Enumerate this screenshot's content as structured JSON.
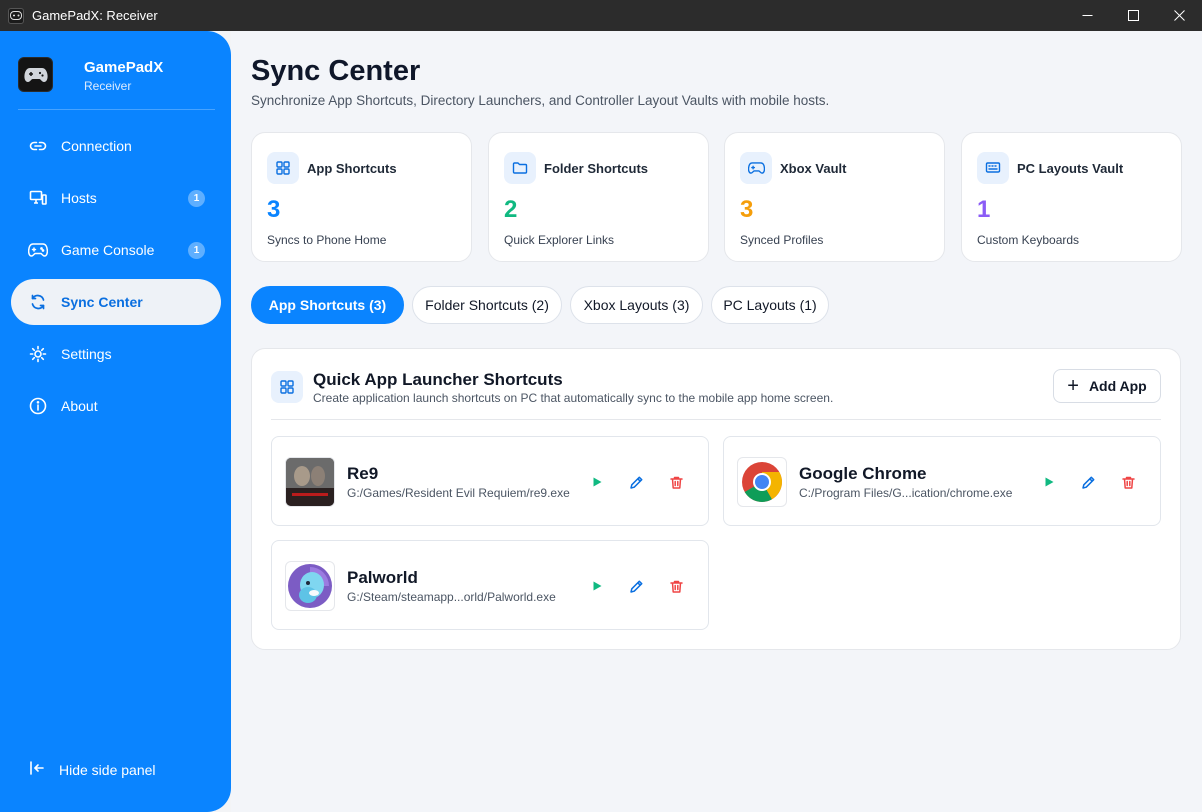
{
  "window": {
    "title": "GamePadX: Receiver"
  },
  "brand": {
    "name": "GamePadX",
    "subtitle": "Receiver"
  },
  "sidebar": {
    "items": [
      {
        "label": "Connection",
        "icon": "link-icon",
        "badge": null
      },
      {
        "label": "Hosts",
        "icon": "monitor-icon",
        "badge": "1"
      },
      {
        "label": "Game Console",
        "icon": "gamepad-icon",
        "badge": "1"
      },
      {
        "label": "Sync Center",
        "icon": "sync-icon",
        "badge": null,
        "active": true
      },
      {
        "label": "Settings",
        "icon": "gear-icon",
        "badge": null
      },
      {
        "label": "About",
        "icon": "info-icon",
        "badge": null
      }
    ],
    "hide_panel": "Hide side panel"
  },
  "page": {
    "title": "Sync Center",
    "subtitle": "Synchronize App Shortcuts, Directory Launchers, and Controller Layout Vaults with mobile hosts."
  },
  "stats": [
    {
      "label": "App Shortcuts",
      "value": "3",
      "caption": "Syncs to Phone Home",
      "color": "#0a84ff"
    },
    {
      "label": "Folder Shortcuts",
      "value": "2",
      "caption": "Quick Explorer Links",
      "color": "#10b981"
    },
    {
      "label": "Xbox Vault",
      "value": "3",
      "caption": "Synced Profiles",
      "color": "#f59e0b"
    },
    {
      "label": "PC Layouts Vault",
      "value": "1",
      "caption": "Custom Keyboards",
      "color": "#8b5cf6"
    }
  ],
  "tabs": [
    {
      "label": "App Shortcuts (3)",
      "active": true
    },
    {
      "label": "Folder Shortcuts (2)",
      "active": false
    },
    {
      "label": "Xbox Layouts (3)",
      "active": false
    },
    {
      "label": "PC Layouts (1)",
      "active": false
    }
  ],
  "panel": {
    "title": "Quick App Launcher Shortcuts",
    "description": "Create application launch shortcuts on PC that automatically sync to the mobile app home screen.",
    "add_label": "Add App"
  },
  "apps": [
    {
      "name": "Re9",
      "path": "G:/Games/Resident Evil Requiem/re9.exe"
    },
    {
      "name": "Google Chrome",
      "path": "C:/Program Files/G...ication/chrome.exe"
    },
    {
      "name": "Palworld",
      "path": "G:/Steam/steamapp...orld/Palworld.exe"
    }
  ],
  "colors": {
    "accent": "#0a84ff",
    "play": "#10b981",
    "edit": "#0a6fe0",
    "delete": "#ef4444"
  }
}
